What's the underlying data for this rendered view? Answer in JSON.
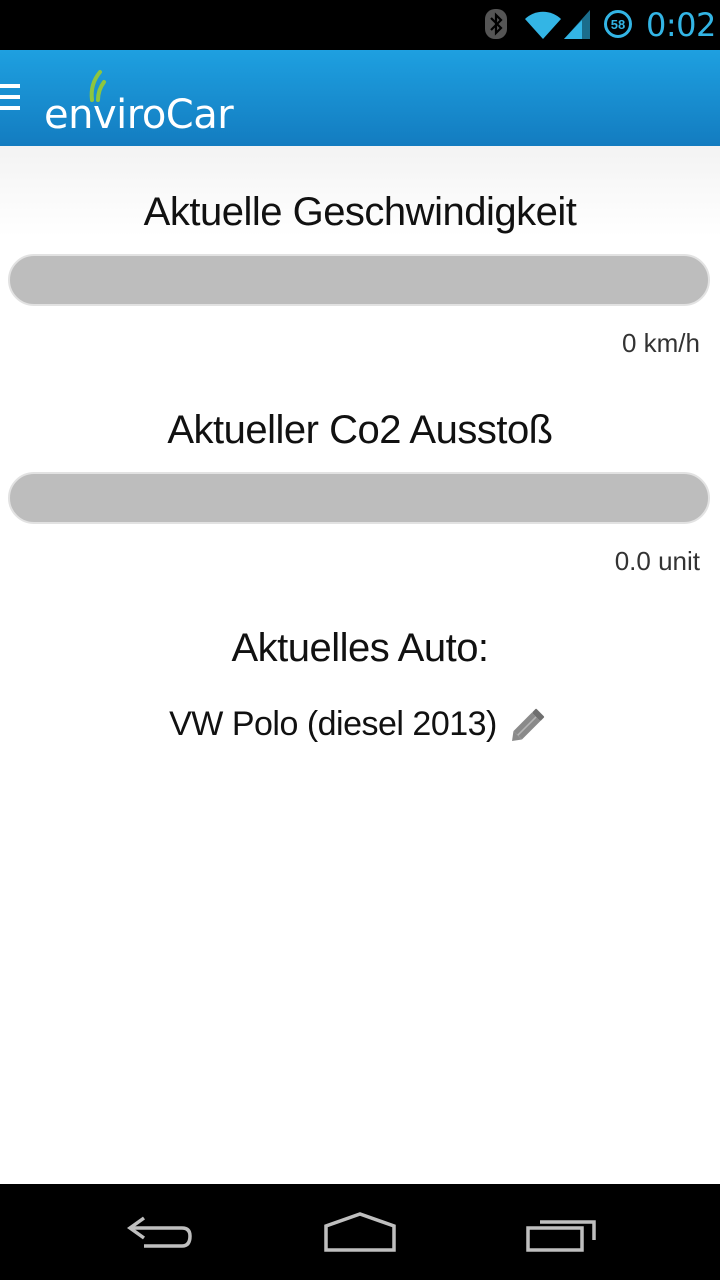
{
  "status_bar": {
    "battery_level": "58",
    "time": "0:02",
    "icons": [
      "bluetooth-icon",
      "wifi-icon",
      "cell-signal-icon",
      "battery-icon"
    ],
    "accent_color": "#33b5e5"
  },
  "action_bar": {
    "logo": "enviroCar",
    "menu_icon": "hamburger-menu-icon",
    "background_color": "#1a8fd3"
  },
  "speed": {
    "heading": "Aktuelle Geschwindigkeit",
    "value": "0 km/h",
    "progress": 0
  },
  "co2": {
    "heading": "Aktueller Co2 Ausstoß",
    "value": "0.0 unit",
    "progress": 0
  },
  "car": {
    "heading": "Aktuelles Auto:",
    "name": "VW Polo (diesel 2013)",
    "edit_icon": "pencil-icon"
  },
  "nav_bar": {
    "buttons": [
      "back-icon",
      "home-icon",
      "recent-apps-icon"
    ]
  }
}
